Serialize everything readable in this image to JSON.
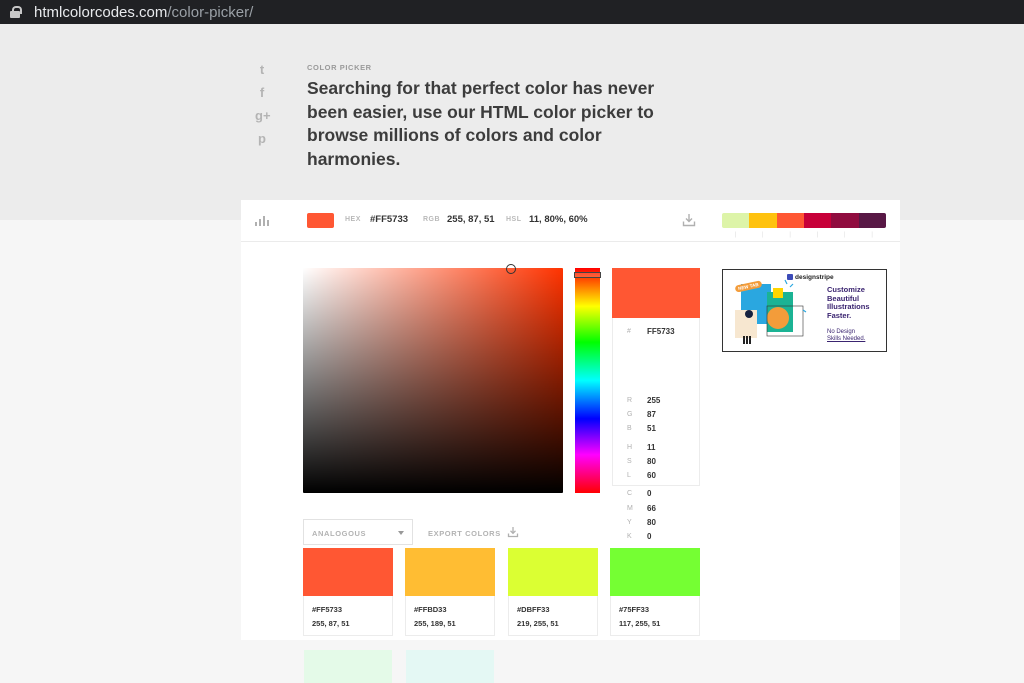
{
  "browser": {
    "url_domain": "htmlcolorcodes.com",
    "url_path": "/color-picker/"
  },
  "hero": {
    "eyebrow": "COLOR PICKER",
    "headline": "Searching for that perfect color has never been easier, use our HTML color picker to browse millions of colors and color harmonies."
  },
  "social": [
    {
      "name": "twitter-icon",
      "glyph": "t"
    },
    {
      "name": "facebook-icon",
      "glyph": "f"
    },
    {
      "name": "google-plus-icon",
      "glyph": "g+"
    },
    {
      "name": "pinterest-icon",
      "glyph": "p"
    }
  ],
  "toolbar": {
    "hex_label": "HEX",
    "hex_value": "#FF5733",
    "rgb_label": "RGB",
    "rgb_value": "255, 87, 51",
    "hsl_label": "HSL",
    "hsl_value": "11, 80%, 60%",
    "current_color": "#FF5733"
  },
  "palette": [
    "#DDF4A8",
    "#FFC20E",
    "#FF5733",
    "#C70039",
    "#900C3F",
    "#581845"
  ],
  "picker": {
    "hue_color": "#FF3300",
    "selected_color": "#FF5733"
  },
  "values": {
    "hash_label": "#",
    "hex": "FF5733",
    "rows": [
      {
        "label": "R",
        "value": "255"
      },
      {
        "label": "G",
        "value": "87"
      },
      {
        "label": "B",
        "value": "51"
      },
      {
        "label": "H",
        "value": "11"
      },
      {
        "label": "S",
        "value": "80"
      },
      {
        "label": "L",
        "value": "60"
      },
      {
        "label": "C",
        "value": "0"
      },
      {
        "label": "M",
        "value": "66"
      },
      {
        "label": "Y",
        "value": "80"
      },
      {
        "label": "K",
        "value": "0"
      }
    ]
  },
  "ad": {
    "brand": "designstripe",
    "tag": "NEW TAB",
    "title": "Customize Beautiful Illustrations Faster.",
    "sub_line1": "No Design",
    "sub_line2": "Skills Needed."
  },
  "harmony": {
    "selected": "ANALOGOUS",
    "export_label": "EXPORT COLORS",
    "colors": [
      {
        "hex": "#FF5733",
        "rgb": "255, 87, 51",
        "color": "#FF5733"
      },
      {
        "hex": "#FFBD33",
        "rgb": "255, 189, 51",
        "color": "#FFBD33"
      },
      {
        "hex": "#DBFF33",
        "rgb": "219, 255, 51",
        "color": "#DBFF33"
      },
      {
        "hex": "#75FF33",
        "rgb": "117, 255, 51",
        "color": "#75FF33"
      }
    ],
    "ghost_colors": [
      "#E4FAE8",
      "#E4F8F4"
    ]
  }
}
